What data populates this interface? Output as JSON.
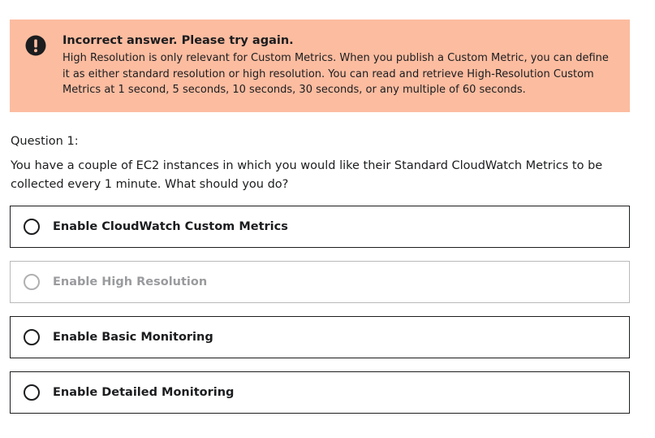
{
  "alert": {
    "icon": "exclamation-circle-icon",
    "title": "Incorrect answer. Please try again.",
    "body": "High Resolution is only relevant for Custom Metrics. When you publish a Custom Metric, you can define it as either standard resolution or high resolution. You can read and retrieve High-Resolution Custom Metrics at 1 second, 5 seconds, 10 seconds, 30 seconds, or any multiple of 60 seconds.",
    "background_color": "#fcbca0"
  },
  "question": {
    "number_label": "Question 1:",
    "text": "You have a couple of EC2 instances in which you would like their Standard CloudWatch Metrics to be collected every 1 minute. What should you do?"
  },
  "options": [
    {
      "label": "Enable CloudWatch Custom Metrics",
      "disabled": false
    },
    {
      "label": "Enable High Resolution",
      "disabled": true
    },
    {
      "label": "Enable Basic Monitoring",
      "disabled": false
    },
    {
      "label": "Enable Detailed Monitoring",
      "disabled": false
    }
  ]
}
